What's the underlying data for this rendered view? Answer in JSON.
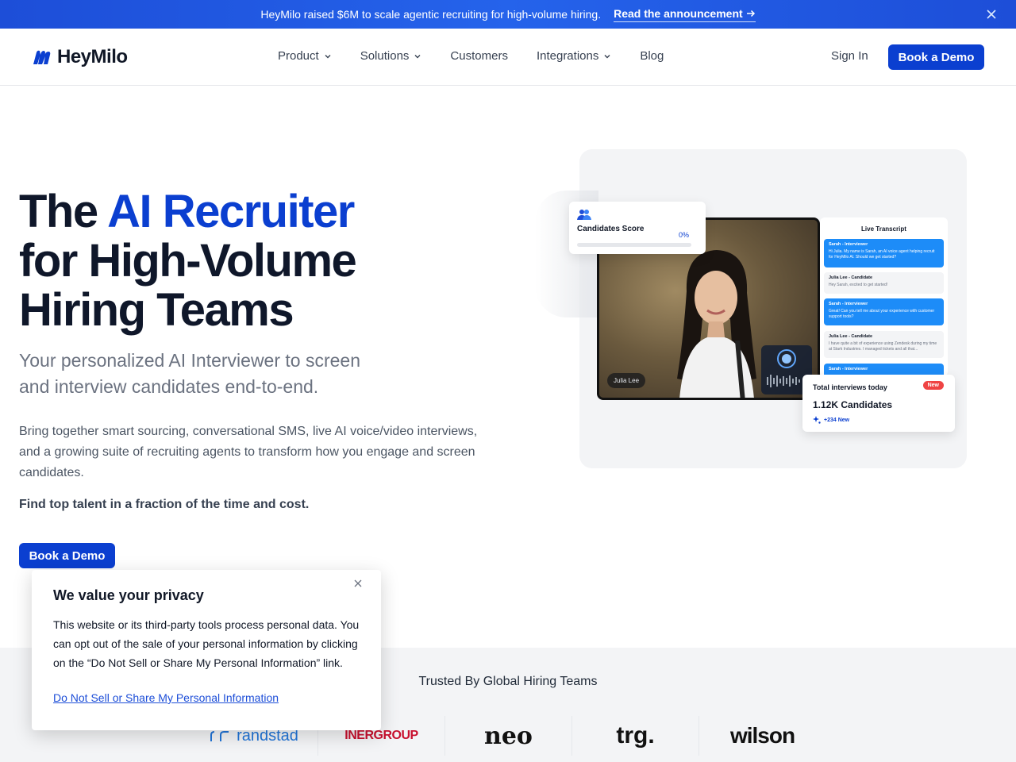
{
  "announcement": {
    "message": "HeyMilo raised $6M to scale agentic recruiting for high-volume hiring.",
    "link_label": "Read the announcement"
  },
  "nav": {
    "brand": "HeyMilo",
    "items": [
      {
        "label": "Product",
        "has_dropdown": true
      },
      {
        "label": "Solutions",
        "has_dropdown": true
      },
      {
        "label": "Customers",
        "has_dropdown": false
      },
      {
        "label": "Integrations",
        "has_dropdown": true
      },
      {
        "label": "Blog",
        "has_dropdown": false
      }
    ],
    "sign_in": "Sign In",
    "cta": "Book a Demo"
  },
  "hero": {
    "title_prefix": "The",
    "title_accent": "AI Recruiter",
    "title_line2": "for High-Volume",
    "title_line3": "Hiring Teams",
    "subtitle": "Your personalized AI Interviewer to screen and interview candidates end-to-end.",
    "body": "Bring together smart sourcing, conversational SMS, live AI voice/video interviews, and a growing suite of recruiting agents to transform how you engage and screen candidates.",
    "emphasis": "Find top talent in a fraction of the time and cost.",
    "cta": "Book a Demo"
  },
  "mockup": {
    "score_label": "Candidates Score",
    "score_value": "0%",
    "candidate_name": "Julia Lee",
    "transcript_title": "Live Transcript",
    "messages": [
      {
        "who": "Sarah - Interviewer",
        "text": "Hi Julia. My name is Sarah, an AI voice agent helping recruit for HeyMilo AI. Should we get started?",
        "style": "blue"
      },
      {
        "who": "Julia Lee - Candidate",
        "text": "Hey Sarah, excited to get started!",
        "style": "grey"
      },
      {
        "who": "Sarah - Interviewer",
        "text": "Great! Can you tell me about your experience with customer support tools?",
        "style": "blue"
      },
      {
        "who": "Julia Lee - Candidate",
        "text": "I have quite a bit of experience using Zendesk during my time at Stark Industries. I managed tickets and all that...",
        "style": "grey"
      },
      {
        "who": "Sarah - Interviewer",
        "text": "",
        "style": "blue"
      }
    ],
    "totals_label": "Total interviews today",
    "totals_badge": "New",
    "totals_value": "1.12K Candidates",
    "totals_delta": "+234 New"
  },
  "trusted": {
    "title": "Trusted By Global Hiring Teams",
    "logos": [
      "randstad",
      "INERGROUP",
      "neo",
      "trg.",
      "wilson"
    ]
  },
  "cookie": {
    "title": "We value your privacy",
    "text": "This website or its third-party tools process personal data. You can opt out of the sale of your personal information by clicking on the “Do Not Sell or Share My Personal Information” link.",
    "link": "Do Not Sell or Share My Personal Information"
  },
  "colors": {
    "brand": "#0b3fd0",
    "announce_bg": "#2563eb",
    "transcript_blue": "#1d8cf8",
    "badge_red": "#ef4444"
  }
}
